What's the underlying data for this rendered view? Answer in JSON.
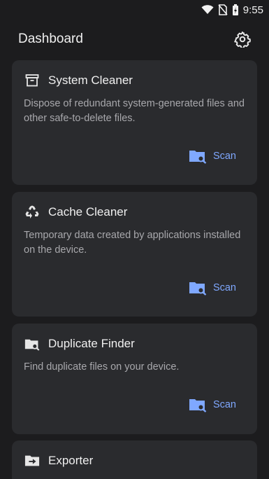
{
  "status_bar": {
    "time": "9:55",
    "icons": [
      "wifi-icon",
      "no-sim-icon",
      "battery-charging-icon"
    ]
  },
  "header": {
    "title": "Dashboard",
    "settings_icon": "gear-icon"
  },
  "colors": {
    "background": "#1c1c1e",
    "card": "#2a2b2e",
    "accent": "#7fa8ff",
    "secondary_text": "#a8a8ac"
  },
  "cards": [
    {
      "icon": "archive-box-icon",
      "title": "System Cleaner",
      "description": "Dispose of redundant system-generated files and other safe-to-delete files.",
      "action_label": "Scan",
      "action_icon": "folder-search-icon"
    },
    {
      "icon": "recycle-icon",
      "title": "Cache Cleaner",
      "description": "Temporary data created by applications installed on the device.",
      "action_label": "Scan",
      "action_icon": "folder-search-icon"
    },
    {
      "icon": "folder-search-icon",
      "title": "Duplicate Finder",
      "description": "Find duplicate files on your device.",
      "action_label": "Scan",
      "action_icon": "folder-search-icon"
    },
    {
      "icon": "folder-export-icon",
      "title": "Exporter"
    }
  ]
}
